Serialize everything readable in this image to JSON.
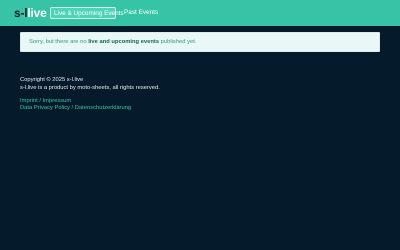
{
  "header": {
    "logo_part1": "s-l",
    "logo_part2": "live",
    "nav": {
      "active": "Live & Upcoming Events",
      "past": "Past Events"
    }
  },
  "notice": {
    "before": "Sorry, but there are no ",
    "strong": "live and upcoming events",
    "after": " published yet."
  },
  "footer": {
    "copyright": "Copyright © 2025 s-l.live",
    "product": "s-l.live is a product by moto-sheets, all rights reserved.",
    "imprint": "Imprint / Impressum",
    "privacy": "Data Privacy Policy / Datenschutzerklärung"
  },
  "colors": {
    "header_bg": "#37c4a6",
    "page_bg": "#051a2a",
    "link": "#36c7a9",
    "notice_bg": "#eaf7f7"
  }
}
